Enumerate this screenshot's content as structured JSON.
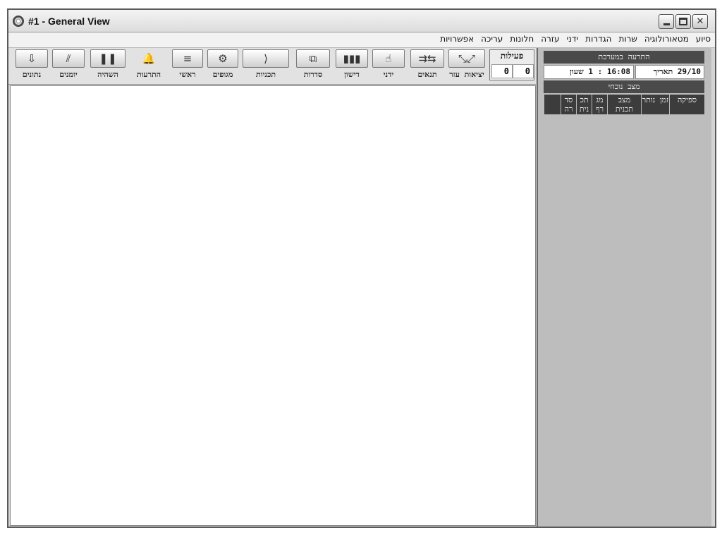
{
  "window": {
    "title": "#1  - General View"
  },
  "menu": {
    "items": [
      "אפשרויות",
      "עריכה",
      "חלונות",
      "עזרה",
      "ידני",
      "הגדרות",
      "שרות",
      "מטאורולוגיה",
      "סיוע"
    ]
  },
  "toolbar": {
    "tools": [
      {
        "label": "יציאות עזר",
        "icon": "aux-outputs-icon",
        "glyph": "⤡⤢"
      },
      {
        "label": "תנאים",
        "icon": "conditions-icon",
        "glyph": "⇉⇆"
      },
      {
        "label": "ידני",
        "icon": "manual-hand-icon",
        "glyph": "☝"
      },
      {
        "label": "דישון",
        "icon": "fertilization-icon",
        "glyph": "▮▮▮"
      },
      {
        "label": "סדרות",
        "icon": "series-icon",
        "glyph": "⧉"
      },
      {
        "label": "תכניות",
        "icon": "programs-icon",
        "glyph": "⟩"
      },
      {
        "label": "מגופים",
        "icon": "valves-icon",
        "glyph": "⚙"
      },
      {
        "label": "ראשי",
        "icon": "main-lines-icon",
        "glyph": "≡"
      },
      {
        "label": "התרעות",
        "icon": "alarm-bell-icon",
        "glyph": "🔔"
      },
      {
        "label": "השהיה",
        "icon": "pause-icon",
        "glyph": "❚❚"
      },
      {
        "label": "יומנים",
        "icon": "logs-icon",
        "glyph": "⫽"
      },
      {
        "label": "נתונים",
        "icon": "data-download-icon",
        "glyph": "⇩"
      }
    ],
    "counter": {
      "title": "פעילות",
      "value_a": "0",
      "value_b": "0"
    }
  },
  "side_panel": {
    "system_header": "התרעה במערכת",
    "date_label": "29/10 תאריך",
    "time_label": "16:08 : 1 שעון",
    "status_header": "מצב נוכחי",
    "status_columns": [
      "ספיקה",
      "זמן נותר",
      "מצב תכנית",
      "מג רף",
      "תכ נית",
      "סד רה",
      ""
    ]
  }
}
